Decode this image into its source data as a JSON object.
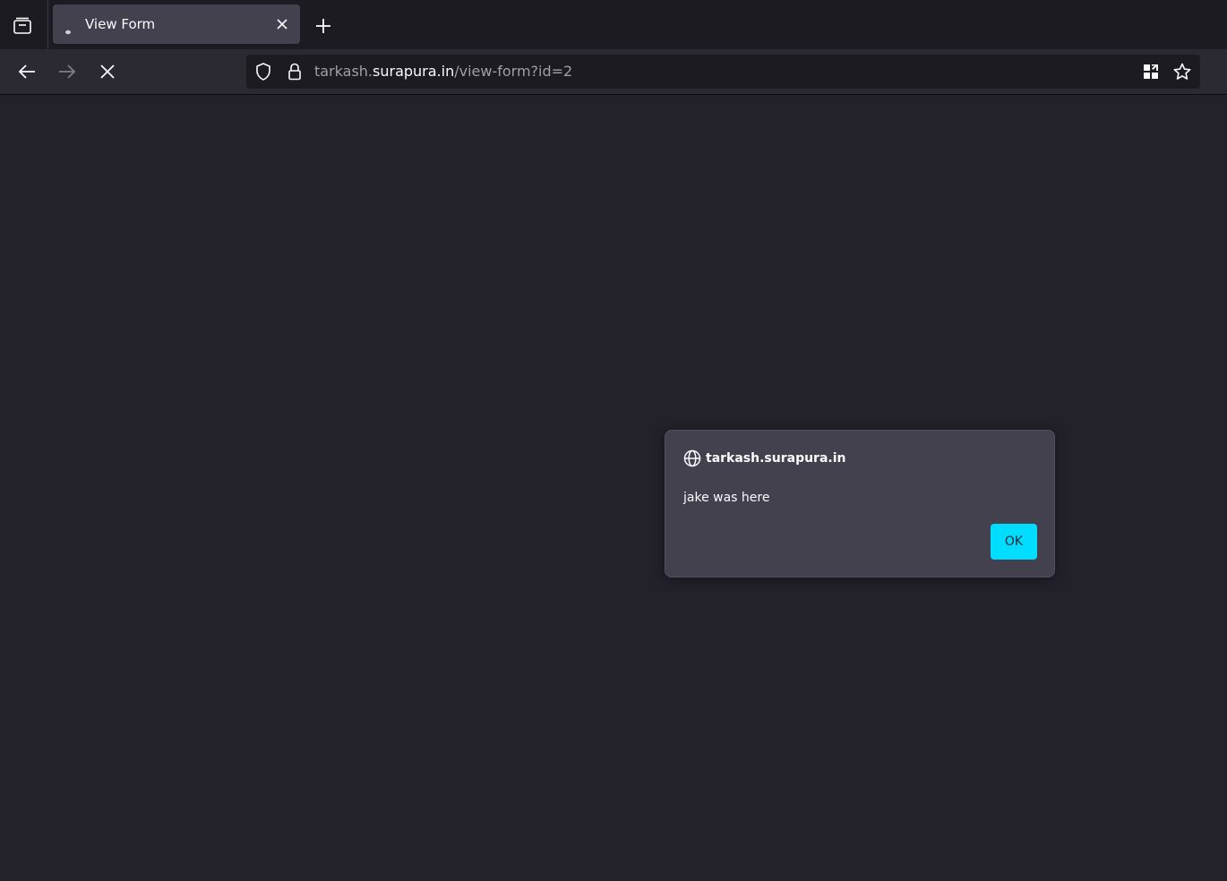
{
  "tab": {
    "title": "View Form"
  },
  "urlbar": {
    "url_prefix": "tarkash.",
    "url_host": "surapura.in",
    "url_path": "/view-form?id=2"
  },
  "dialog": {
    "origin": "tarkash.surapura.in",
    "message": "jake was here",
    "ok_label": "OK"
  },
  "colors": {
    "accent": "#00ddff",
    "content_bg": "#23222b",
    "dialog_bg": "#42414d"
  },
  "icons": {
    "tab_manager": "tab-manager-icon",
    "favicon": "loading-dot-icon",
    "tab_close": "close-icon",
    "new_tab": "plus-icon",
    "back": "arrow-left-icon",
    "forward": "arrow-right-icon",
    "stop": "stop-icon",
    "tracking": "shield-icon",
    "lock": "lock-icon",
    "qr": "qr-code-icon",
    "bookmark": "star-icon",
    "dialog_origin": "globe-icon"
  }
}
